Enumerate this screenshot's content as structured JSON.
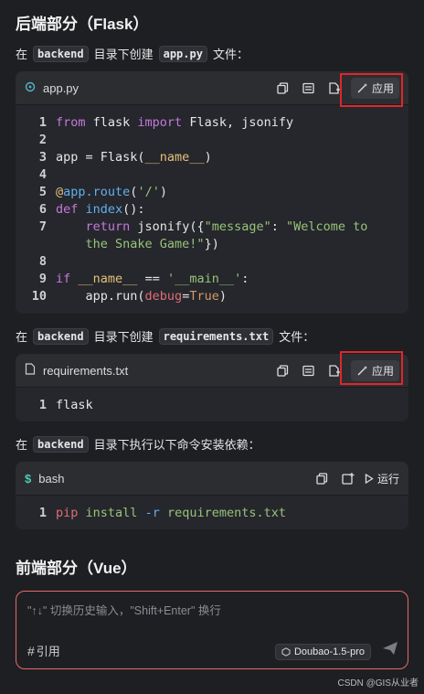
{
  "backend_heading": "后端部分（Flask）",
  "para1": {
    "pre": "在",
    "code1": "backend",
    "mid": "目录下创建",
    "code2": "app.py",
    "post": "文件："
  },
  "block1": {
    "lang": "app.py",
    "apply_label": "应用",
    "lines": [
      {
        "n": "1"
      },
      {
        "n": "2"
      },
      {
        "n": "3"
      },
      {
        "n": "4"
      },
      {
        "n": "5"
      },
      {
        "n": "6"
      },
      {
        "n": "7"
      },
      {
        "n": ""
      },
      {
        "n": "8"
      },
      {
        "n": "9"
      },
      {
        "n": "10"
      }
    ]
  },
  "para2": {
    "pre": "在",
    "code1": "backend",
    "mid": "目录下创建",
    "code2": "requirements.txt",
    "post": "文件："
  },
  "block2": {
    "lang": "requirements.txt",
    "apply_label": "应用",
    "line1_num": "1",
    "line1_text": "flask"
  },
  "para3": {
    "pre": "在",
    "code1": "backend",
    "post": "目录下执行以下命令安装依赖："
  },
  "block3": {
    "lang": "bash",
    "run_label": "运行",
    "line1_num": "1"
  },
  "frontend_heading": "前端部分（Vue）",
  "input": {
    "placeholder": "\"↑↓\" 切换历史输入，\"Shift+Enter\" 换行",
    "ref_label": "引用",
    "model": "Doubao-1.5-pro"
  },
  "watermark": "CSDN @GIS从业者"
}
